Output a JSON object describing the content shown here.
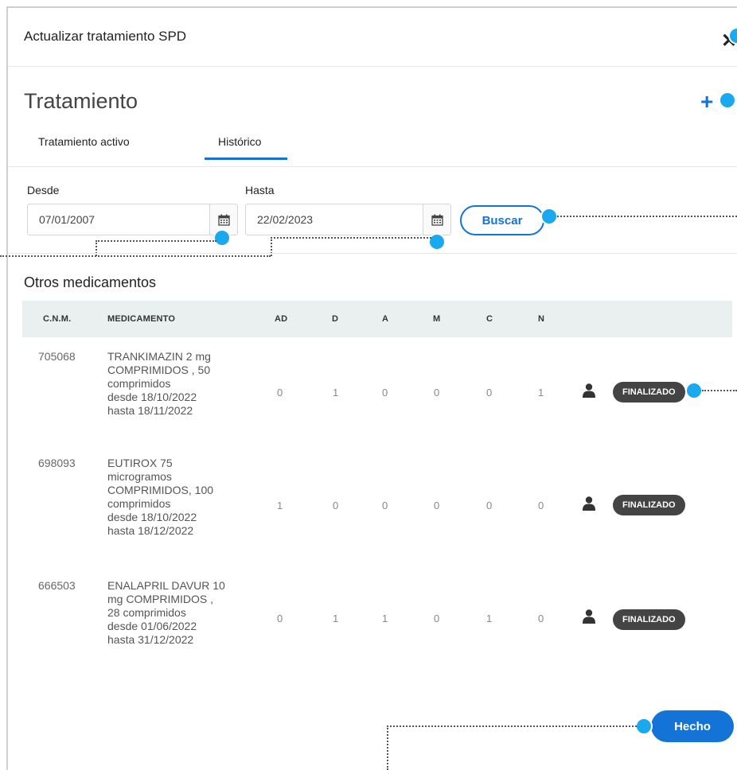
{
  "modal": {
    "title": "Actualizar tratamiento SPD"
  },
  "section": {
    "title": "Tratamiento"
  },
  "tabs": [
    {
      "label": "Tratamiento activo",
      "active": false
    },
    {
      "label": "Histórico",
      "active": true
    }
  ],
  "filters": {
    "from_label": "Desde",
    "from_value": "07/01/2007",
    "to_label": "Hasta",
    "to_value": "22/02/2023",
    "search_label": "Buscar"
  },
  "table": {
    "title": "Otros medicamentos",
    "headers": [
      "C.N.M.",
      "MEDICAMENTO",
      "AD",
      "D",
      "A",
      "M",
      "C",
      "N"
    ],
    "rows": [
      {
        "cnm": "705068",
        "medicamento": "TRANKIMAZIN 2 mg\nCOMPRIMIDOS , 50\ncomprimidos\ndesde 18/10/2022\nhasta 18/11/2022",
        "ad": "0",
        "d": "1",
        "a": "0",
        "m": "0",
        "c": "0",
        "n": "1",
        "status": "FINALIZADO"
      },
      {
        "cnm": "698093",
        "medicamento": "EUTIROX 75\nmicrogramos\nCOMPRIMIDOS, 100\ncomprimidos\ndesde 18/10/2022\nhasta 18/12/2022",
        "ad": "1",
        "d": "0",
        "a": "0",
        "m": "0",
        "c": "0",
        "n": "0",
        "status": "FINALIZADO"
      },
      {
        "cnm": "666503",
        "medicamento": "ENALAPRIL DAVUR 10\nmg COMPRIMIDOS ,\n28 comprimidos\ndesde 01/06/2022\nhasta 31/12/2022",
        "ad": "0",
        "d": "1",
        "a": "1",
        "m": "0",
        "c": "1",
        "n": "0",
        "status": "FINALIZADO"
      }
    ]
  },
  "footer": {
    "done_label": "Hecho"
  },
  "icons": {
    "close": "close-icon",
    "add": "plus-icon",
    "calendar": "calendar-icon",
    "user": "user-icon"
  },
  "colors": {
    "accent": "#1473d6",
    "hotspot": "#1aa9ee",
    "badge": "#444444",
    "table_header": "#eaeff0"
  }
}
